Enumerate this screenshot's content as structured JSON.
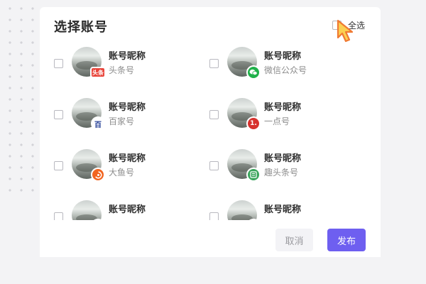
{
  "dialog": {
    "title": "选择账号",
    "select_all_label": "全选"
  },
  "accounts": [
    {
      "nickname": "账号昵称",
      "platform": "头条号",
      "badge_icon": "toutiao-icon",
      "badge_text": "头条",
      "badge_color": "#e8443a"
    },
    {
      "nickname": "账号昵称",
      "platform": "微信公众号",
      "badge_icon": "wechat-icon",
      "badge_text": "",
      "badge_color": "#20b14a"
    },
    {
      "nickname": "账号昵称",
      "platform": "百家号",
      "badge_icon": "baijiahao-icon",
      "badge_text": "百",
      "badge_color": "#ffffff"
    },
    {
      "nickname": "账号昵称",
      "platform": "一点号",
      "badge_icon": "yidian-icon",
      "badge_text": "1.",
      "badge_color": "#d7322e"
    },
    {
      "nickname": "账号昵称",
      "platform": "大鱼号",
      "badge_icon": "dayu-icon",
      "badge_text": "",
      "badge_color": "#f2641f"
    },
    {
      "nickname": "账号昵称",
      "platform": "趣头条号",
      "badge_icon": "qutoutiao-icon",
      "badge_text": "",
      "badge_color": "#3aa55c"
    },
    {
      "nickname": "账号昵称",
      "platform": "",
      "badge_icon": "partial-badge-icon",
      "badge_text": "",
      "badge_color": "#e6c21f"
    },
    {
      "nickname": "账号昵称",
      "platform": "",
      "badge_icon": "partial-badge-icon",
      "badge_text": "",
      "badge_color": "#4a8fe0"
    }
  ],
  "footer": {
    "cancel_label": "取消",
    "publish_label": "发布"
  },
  "colors": {
    "accent": "#6e5ff0",
    "cursor_fill": "#fbd052",
    "cursor_stroke": "#f07a33"
  }
}
